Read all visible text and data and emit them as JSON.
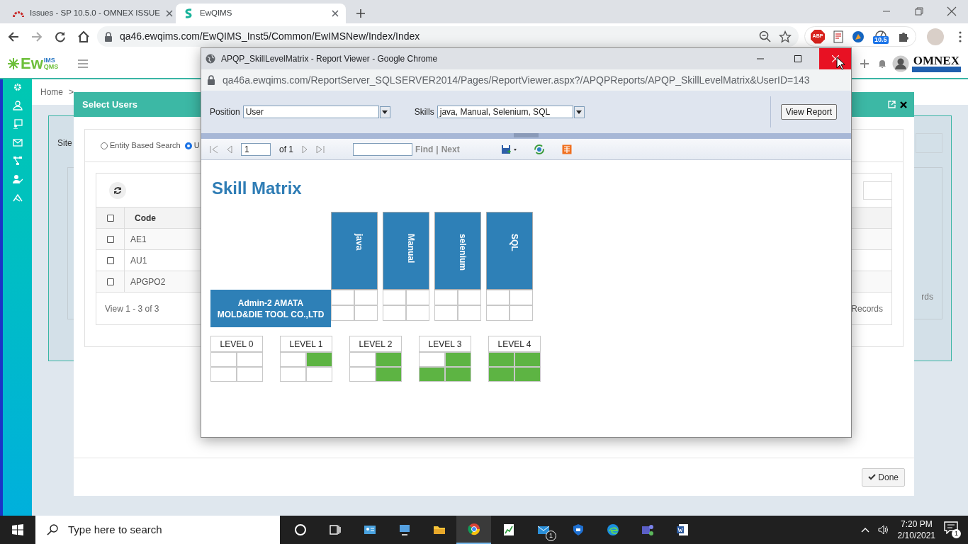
{
  "browser": {
    "tabs": [
      {
        "kind": "issues",
        "title": "Issues - SP 10.5.0 - OMNEX ISSUE",
        "selected": false
      },
      {
        "kind": "app",
        "title": "EwQIMS",
        "selected": true
      }
    ],
    "address": "qa46.ewqims.com/EwQIMS_Inst5/Common/EwIMSNew/Index/Index",
    "adblock": "ABP",
    "extension_badge": "10.5"
  },
  "app": {
    "logo": {
      "main": "Ew",
      "top": "IMS",
      "bottom": "QMS"
    },
    "company_logo": "OMNEX",
    "breadcrumb": [
      "Home",
      ">"
    ]
  },
  "background": {
    "site_label": "Site",
    "records_fragment": "rds"
  },
  "modal": {
    "title": "Select Users",
    "search_modes": [
      {
        "label": "Entity Based Search",
        "selected": false
      },
      {
        "label": "U",
        "selected": true
      }
    ],
    "header_checked": false,
    "columns": [
      "Code"
    ],
    "rows": [
      {
        "code": "AE1",
        "checked": false
      },
      {
        "code": "AU1",
        "checked": false
      },
      {
        "code": "APGPO2",
        "checked": false
      }
    ],
    "pager": "View 1 - 3 of 3",
    "records_label": "Records",
    "done": "Done"
  },
  "report_window": {
    "title": "APQP_SkillLevelMatrix - Report Viewer - Google Chrome",
    "url": "qa46a.ewqims.com/ReportServer_SQLSERVER2014/Pages/ReportViewer.aspx?/APQPReports/APQP_SkillLevelMatrix&UserID=143",
    "parameters": [
      {
        "label": "Position",
        "value": "User"
      },
      {
        "label": "Skills",
        "value": "java, Manual, Selenium, SQL"
      }
    ],
    "view_report": "View Report",
    "toolbar": {
      "page": "1",
      "page_count": "of 1",
      "find": "Find",
      "separator": "|",
      "next": "Next"
    },
    "report": {
      "title": "Skill Matrix",
      "entity": "Admin-2 AMATA MOLD&DIE TOOL CO.,LTD",
      "skills": [
        {
          "name": "java",
          "cells": [
            false,
            false,
            false,
            false
          ]
        },
        {
          "name": "Manual",
          "cells": [
            false,
            false,
            false,
            false
          ]
        },
        {
          "name": "selenium",
          "cells": [
            false,
            false,
            false,
            false
          ]
        },
        {
          "name": "SQL",
          "cells": [
            false,
            false,
            false,
            false
          ]
        }
      ],
      "legend": [
        {
          "label": "LEVEL 0",
          "cells": [
            false,
            false,
            false,
            false
          ]
        },
        {
          "label": "LEVEL 1",
          "cells": [
            false,
            true,
            false,
            false
          ]
        },
        {
          "label": "LEVEL 2",
          "cells": [
            false,
            true,
            false,
            true
          ]
        },
        {
          "label": "LEVEL 3",
          "cells": [
            false,
            true,
            true,
            true
          ]
        },
        {
          "label": "LEVEL 4",
          "cells": [
            true,
            true,
            true,
            true
          ]
        }
      ]
    }
  },
  "taskbar": {
    "search_placeholder": "Type here to search",
    "mail_badge": "1",
    "time": "7:20 PM",
    "date": "2/10/2021",
    "notifications": "1"
  }
}
